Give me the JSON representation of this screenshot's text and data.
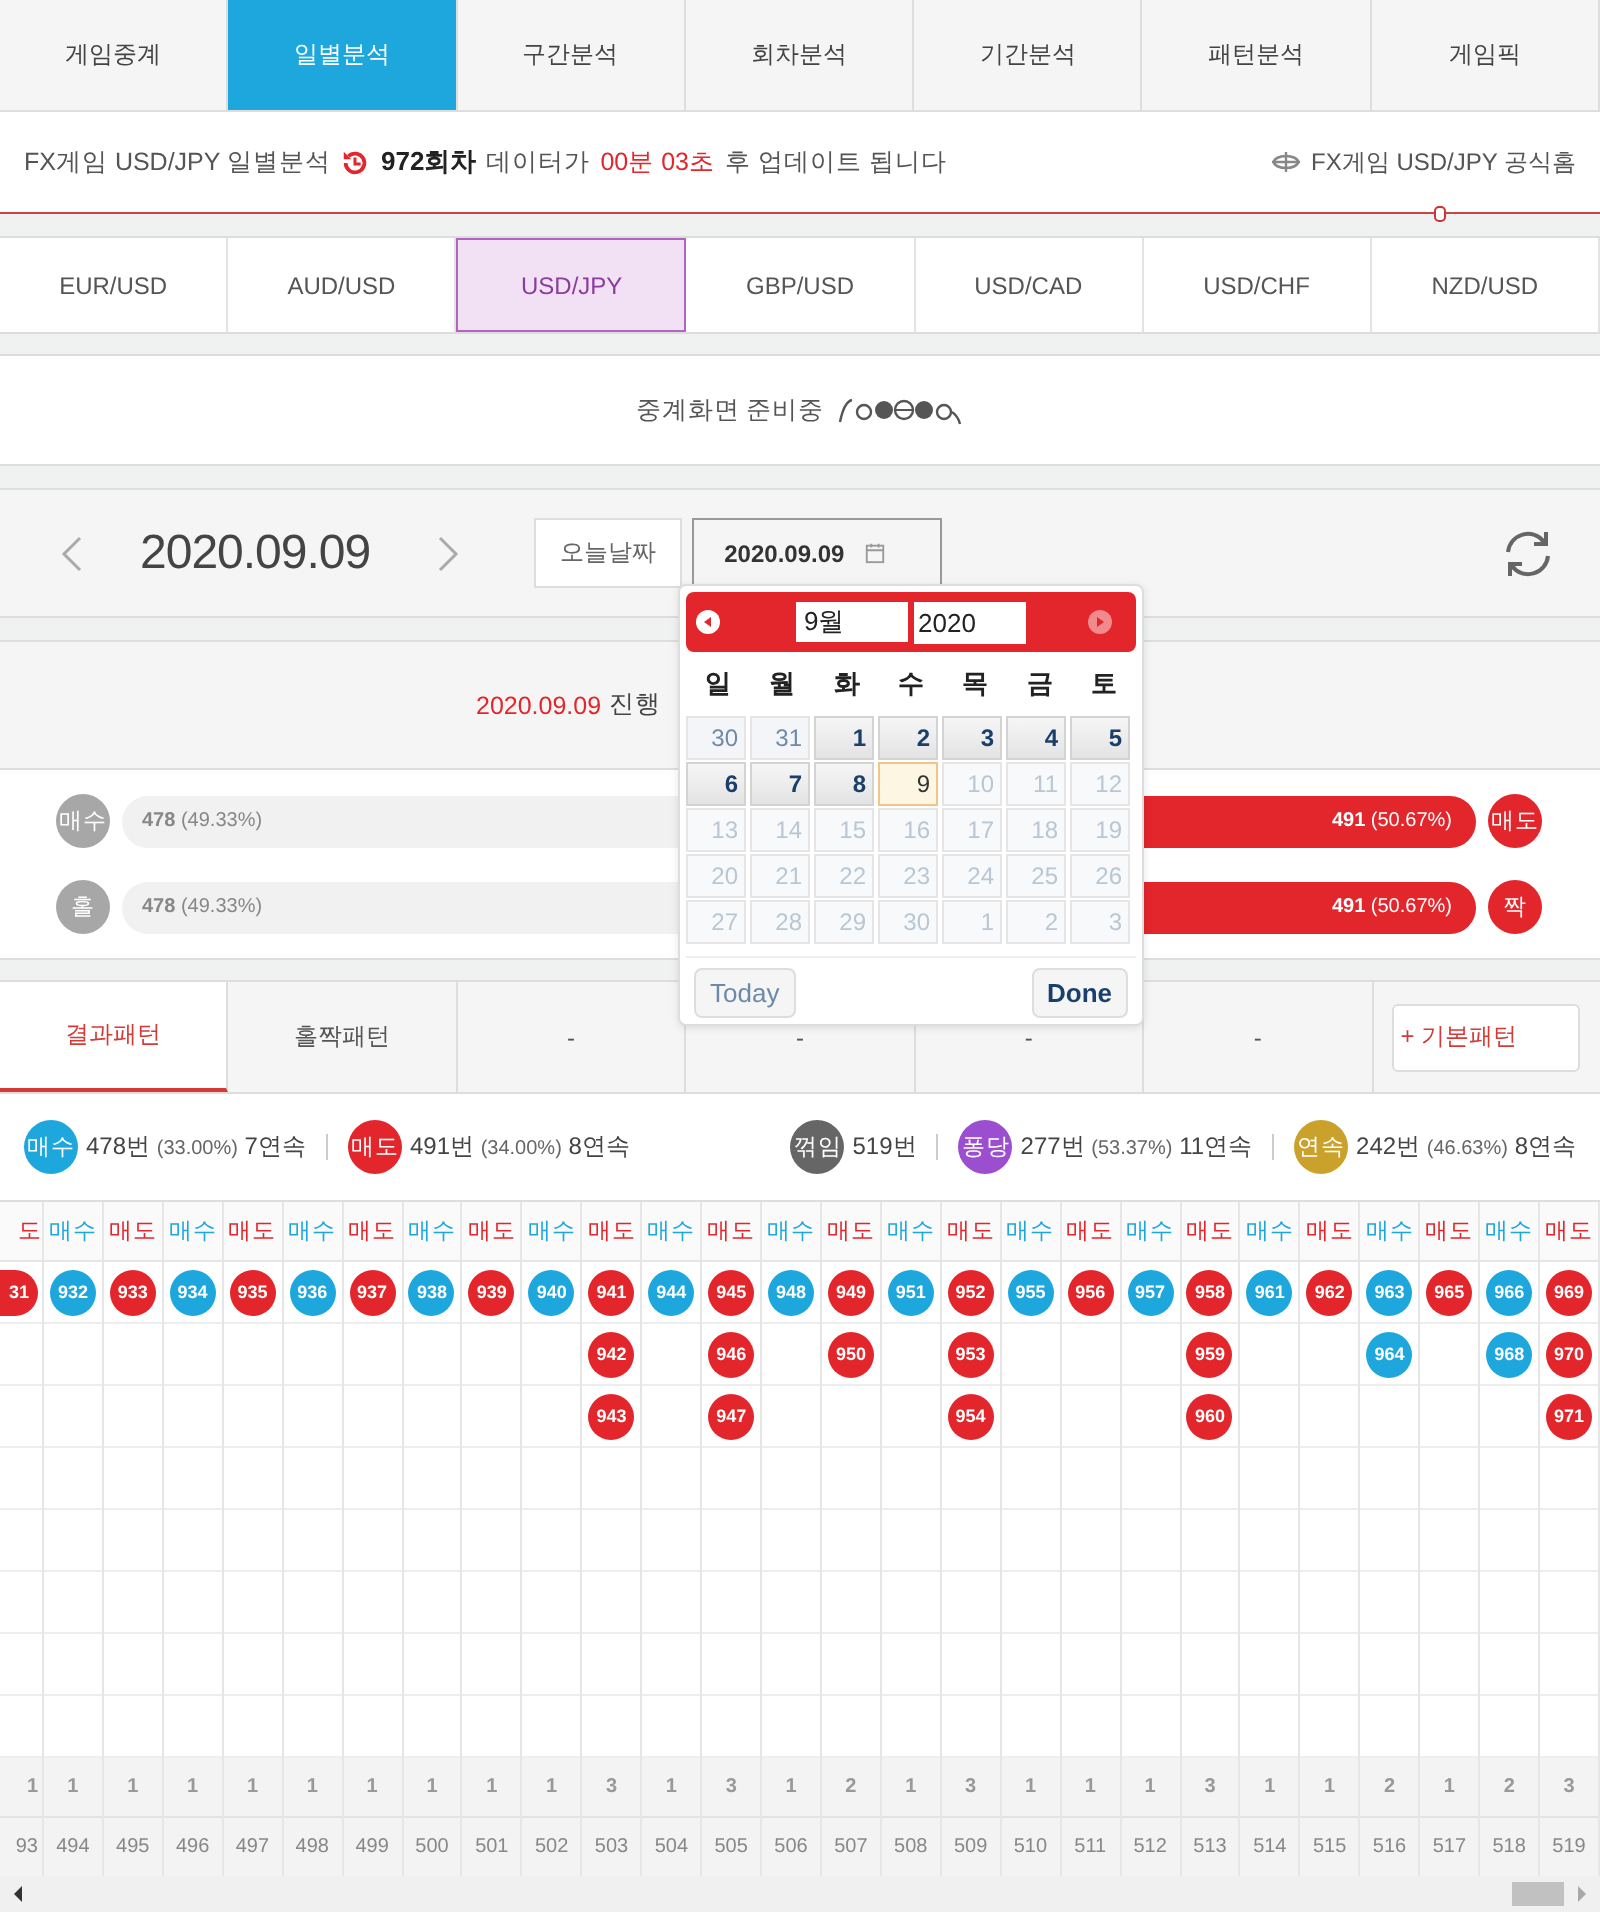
{
  "main_tabs": [
    {
      "label": "게임중계",
      "selected": false
    },
    {
      "label": "일별분석",
      "selected": true
    },
    {
      "label": "구간분석",
      "selected": false
    },
    {
      "label": "회차분석",
      "selected": false
    },
    {
      "label": "기간분석",
      "selected": false
    },
    {
      "label": "패턴분석",
      "selected": false
    },
    {
      "label": "게임픽",
      "selected": false
    }
  ],
  "info_bar": {
    "prefix": "FX게임 USD/JPY 일별분석",
    "round": "972회차",
    "middle": "데이터가",
    "countdown": "00분 03초",
    "suffix": "후 업데이트 됩니다",
    "home_link": "FX게임 USD/JPY 공식홈"
  },
  "currency_tabs": [
    {
      "label": "EUR/USD",
      "selected": false
    },
    {
      "label": "AUD/USD",
      "selected": false
    },
    {
      "label": "USD/JPY",
      "selected": true
    },
    {
      "label": "GBP/USD",
      "selected": false
    },
    {
      "label": "USD/CAD",
      "selected": false
    },
    {
      "label": "USD/CHF",
      "selected": false
    },
    {
      "label": "NZD/USD",
      "selected": false
    }
  ],
  "broadcast": {
    "message": "중계화면 준비중"
  },
  "date_bar": {
    "date": "2020.09.09",
    "today_button": "오늘날짜",
    "date_field": "2020.09.09"
  },
  "calendar": {
    "month": "9월",
    "year": "2020",
    "weekdays": [
      "일",
      "월",
      "화",
      "수",
      "목",
      "금",
      "토"
    ],
    "days": [
      {
        "text": "30",
        "kind": "outside"
      },
      {
        "text": "31",
        "kind": "outside"
      },
      {
        "text": "1",
        "kind": "available"
      },
      {
        "text": "2",
        "kind": "available"
      },
      {
        "text": "3",
        "kind": "available"
      },
      {
        "text": "4",
        "kind": "available"
      },
      {
        "text": "5",
        "kind": "available"
      },
      {
        "text": "6",
        "kind": "available"
      },
      {
        "text": "7",
        "kind": "available"
      },
      {
        "text": "8",
        "kind": "available"
      },
      {
        "text": "9",
        "kind": "today"
      },
      {
        "text": "10",
        "kind": "disabled"
      },
      {
        "text": "11",
        "kind": "disabled"
      },
      {
        "text": "12",
        "kind": "disabled"
      },
      {
        "text": "13",
        "kind": "disabled"
      },
      {
        "text": "14",
        "kind": "disabled"
      },
      {
        "text": "15",
        "kind": "disabled"
      },
      {
        "text": "16",
        "kind": "disabled"
      },
      {
        "text": "17",
        "kind": "disabled"
      },
      {
        "text": "18",
        "kind": "disabled"
      },
      {
        "text": "19",
        "kind": "disabled"
      },
      {
        "text": "20",
        "kind": "disabled"
      },
      {
        "text": "21",
        "kind": "disabled"
      },
      {
        "text": "22",
        "kind": "disabled"
      },
      {
        "text": "23",
        "kind": "disabled"
      },
      {
        "text": "24",
        "kind": "disabled"
      },
      {
        "text": "25",
        "kind": "disabled"
      },
      {
        "text": "26",
        "kind": "disabled"
      },
      {
        "text": "27",
        "kind": "disabled"
      },
      {
        "text": "28",
        "kind": "disabled"
      },
      {
        "text": "29",
        "kind": "disabled"
      },
      {
        "text": "30",
        "kind": "disabled"
      },
      {
        "text": "1",
        "kind": "disabled"
      },
      {
        "text": "2",
        "kind": "disabled"
      },
      {
        "text": "3",
        "kind": "disabled"
      }
    ],
    "today_button": "Today",
    "done_button": "Done"
  },
  "stats": {
    "date": "2020.09.09",
    "title_rest": "진행",
    "bars": [
      {
        "left_badge": "매수",
        "left_value": "478",
        "left_pct": "(49.33%)",
        "right_value": "491",
        "right_pct": "(50.67%)",
        "right_badge": "매도",
        "level": 0.5067
      },
      {
        "left_badge": "홀",
        "left_value": "478",
        "left_pct": "(49.33%)",
        "right_value": "491",
        "right_pct": "(50.67%)",
        "right_badge": "짝",
        "level": 0.5067
      }
    ]
  },
  "pattern_tabs": [
    {
      "label": "결과패턴",
      "selected": true
    },
    {
      "label": "홀짝패턴",
      "selected": false
    },
    {
      "label": "-",
      "selected": false
    },
    {
      "label": "-",
      "selected": false
    },
    {
      "label": "-",
      "selected": false
    },
    {
      "label": "-",
      "selected": false
    }
  ],
  "basic_pattern_button": "+ 기본패턴",
  "summary_left": [
    {
      "badge": "매수",
      "color": "#1ea7dd",
      "count": "478번",
      "pct": "(33.00%)",
      "streak": "7연속"
    },
    {
      "badge": "매도",
      "color": "#e2262b",
      "count": "491번",
      "pct": "(34.00%)",
      "streak": "8연속"
    }
  ],
  "summary_right": [
    {
      "badge": "꺾임",
      "color": "#666666",
      "count": "519번"
    },
    {
      "badge": "퐁당",
      "color": "#9b4fd0",
      "count": "277번",
      "pct": "(53.37%)",
      "streak": "11연속"
    },
    {
      "badge": "연속",
      "color": "#caa12a",
      "count": "242번",
      "pct": "(46.63%)",
      "streak": "8연속"
    }
  ],
  "grid": [
    {
      "kind": "sell",
      "label": "도",
      "balls": [
        "31"
      ],
      "count": "1",
      "index": "93"
    },
    {
      "kind": "buy",
      "label": "매수",
      "balls": [
        "932"
      ],
      "count": "1",
      "index": "494"
    },
    {
      "kind": "sell",
      "label": "매도",
      "balls": [
        "933"
      ],
      "count": "1",
      "index": "495"
    },
    {
      "kind": "buy",
      "label": "매수",
      "balls": [
        "934"
      ],
      "count": "1",
      "index": "496"
    },
    {
      "kind": "sell",
      "label": "매도",
      "balls": [
        "935"
      ],
      "count": "1",
      "index": "497"
    },
    {
      "kind": "buy",
      "label": "매수",
      "balls": [
        "936"
      ],
      "count": "1",
      "index": "498"
    },
    {
      "kind": "sell",
      "label": "매도",
      "balls": [
        "937"
      ],
      "count": "1",
      "index": "499"
    },
    {
      "kind": "buy",
      "label": "매수",
      "balls": [
        "938"
      ],
      "count": "1",
      "index": "500"
    },
    {
      "kind": "sell",
      "label": "매도",
      "balls": [
        "939"
      ],
      "count": "1",
      "index": "501"
    },
    {
      "kind": "buy",
      "label": "매수",
      "balls": [
        "940"
      ],
      "count": "1",
      "index": "502"
    },
    {
      "kind": "sell",
      "label": "매도",
      "balls": [
        "941",
        "942",
        "943"
      ],
      "count": "3",
      "index": "503"
    },
    {
      "kind": "buy",
      "label": "매수",
      "balls": [
        "944"
      ],
      "count": "1",
      "index": "504"
    },
    {
      "kind": "sell",
      "label": "매도",
      "balls": [
        "945",
        "946",
        "947"
      ],
      "count": "3",
      "index": "505"
    },
    {
      "kind": "buy",
      "label": "매수",
      "balls": [
        "948"
      ],
      "count": "1",
      "index": "506"
    },
    {
      "kind": "sell",
      "label": "매도",
      "balls": [
        "949",
        "950"
      ],
      "count": "2",
      "index": "507"
    },
    {
      "kind": "buy",
      "label": "매수",
      "balls": [
        "951"
      ],
      "count": "1",
      "index": "508"
    },
    {
      "kind": "sell",
      "label": "매도",
      "balls": [
        "952",
        "953",
        "954"
      ],
      "count": "3",
      "index": "509"
    },
    {
      "kind": "buy",
      "label": "매수",
      "balls": [
        "955"
      ],
      "count": "1",
      "index": "510"
    },
    {
      "kind": "sell",
      "label": "매도",
      "balls": [
        "956"
      ],
      "count": "1",
      "index": "511"
    },
    {
      "kind": "buy",
      "label": "매수",
      "balls": [
        "957"
      ],
      "count": "1",
      "index": "512"
    },
    {
      "kind": "sell",
      "label": "매도",
      "balls": [
        "958",
        "959",
        "960"
      ],
      "count": "3",
      "index": "513"
    },
    {
      "kind": "buy",
      "label": "매수",
      "balls": [
        "961"
      ],
      "count": "1",
      "index": "514"
    },
    {
      "kind": "sell",
      "label": "매도",
      "balls": [
        "962"
      ],
      "count": "1",
      "index": "515"
    },
    {
      "kind": "buy",
      "label": "매수",
      "balls": [
        "963",
        "964"
      ],
      "count": "2",
      "index": "516"
    },
    {
      "kind": "sell",
      "label": "매도",
      "balls": [
        "965"
      ],
      "count": "1",
      "index": "517"
    },
    {
      "kind": "buy",
      "label": "매수",
      "balls": [
        "966",
        "968"
      ],
      "count": "2",
      "index": "518"
    },
    {
      "kind": "sell",
      "label": "매도",
      "balls": [
        "969",
        "970",
        "971"
      ],
      "count": "3",
      "index": "519"
    }
  ]
}
